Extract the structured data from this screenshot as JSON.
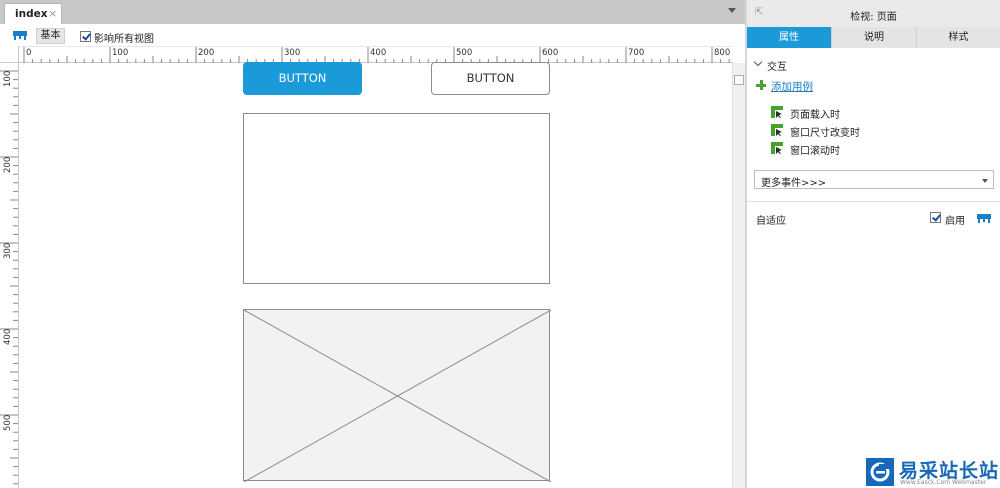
{
  "tab": {
    "label": "index",
    "close": "×"
  },
  "toolbar": {
    "base_label": "基本",
    "affect_all_label": "影响所有视图",
    "affect_all_checked": true
  },
  "ruler": {
    "h_labels": [
      "0",
      "100",
      "200",
      "300",
      "400",
      "500",
      "600",
      "700",
      "800"
    ],
    "v_labels": [
      "100",
      "200",
      "300",
      "400",
      "500"
    ]
  },
  "canvas": {
    "button_primary": "BUTTON",
    "button_default": "BUTTON"
  },
  "panel": {
    "title": "检视: 页面",
    "tabs": [
      {
        "label": "属性",
        "active": true
      },
      {
        "label": "说明",
        "active": false
      },
      {
        "label": "样式",
        "active": false
      }
    ],
    "section_title": "交互",
    "add_case": "添加用例",
    "events": [
      "页面载入时",
      "窗口尺寸改变时",
      "窗口滚动时"
    ],
    "more_events": "更多事件>>>",
    "adaptive_label": "自适应",
    "enable_label": "启用",
    "enable_checked": true
  },
  "watermark": {
    "text": "易采站长站",
    "sub": "Www.Easck.Com Webmaster"
  },
  "colors": {
    "accent": "#1a9ad8",
    "link": "#1a7fc6",
    "green": "#4aa22e",
    "brand": "#1768b8"
  }
}
